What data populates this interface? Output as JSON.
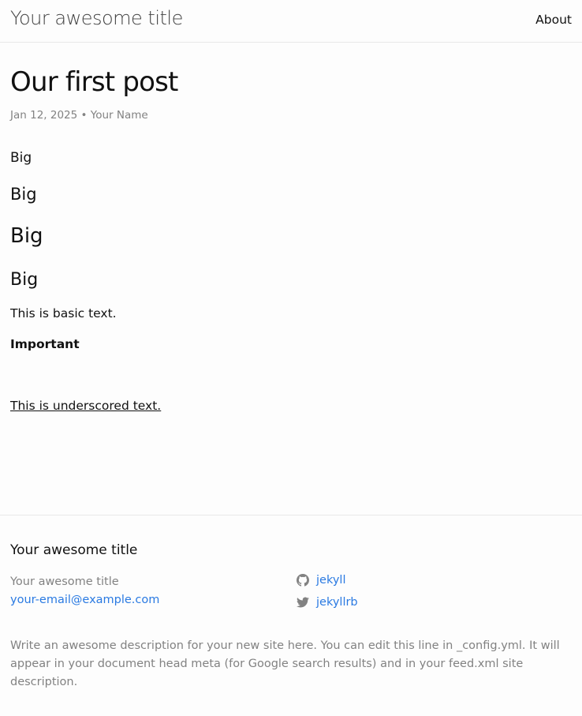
{
  "header": {
    "site_title": "Your awesome title",
    "nav": {
      "about_label": "About"
    }
  },
  "post": {
    "title": "Our first post",
    "meta": "Jan 12, 2025 • Your Name",
    "headings": [
      "Big",
      "Big",
      "Big",
      "Big"
    ],
    "basic_text": "This is basic text.",
    "important_text": "Important",
    "underscored_text": "This is underscored text."
  },
  "footer": {
    "heading": "Your awesome title",
    "author_name": "Your awesome title",
    "email": "your-email@example.com",
    "github": {
      "username": "jekyll",
      "icon": "github-icon"
    },
    "twitter": {
      "username": "jekyllrb",
      "icon": "twitter-icon"
    },
    "description": "Write an awesome description for your new site here. You can edit this line in _config.yml. It will appear in your document head meta (for Google search results) and in your feed.xml site description."
  },
  "colors": {
    "background": "#fdfdfd",
    "text": "#111111",
    "muted": "#828282",
    "link": "#2a7ae2",
    "border": "#e8e8e8"
  }
}
